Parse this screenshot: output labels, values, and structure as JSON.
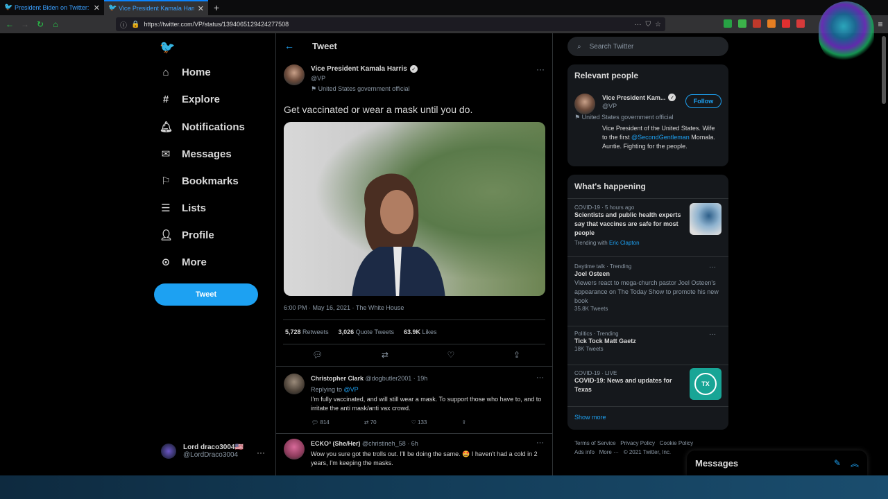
{
  "browser": {
    "tabs": [
      {
        "label": "President Biden on Twitter: \"Be",
        "active": false
      },
      {
        "label": "Vice President Kamala Harris",
        "active": true
      }
    ],
    "url": "https://twitter.com/VP/status/1394065129424277508"
  },
  "nav": {
    "items": [
      {
        "label": "Home",
        "icon": "home-icon"
      },
      {
        "label": "Explore",
        "icon": "hashtag-icon"
      },
      {
        "label": "Notifications",
        "icon": "bell-icon"
      },
      {
        "label": "Messages",
        "icon": "mail-icon"
      },
      {
        "label": "Bookmarks",
        "icon": "bookmark-icon"
      },
      {
        "label": "Lists",
        "icon": "list-icon"
      },
      {
        "label": "Profile",
        "icon": "person-icon"
      },
      {
        "label": "More",
        "icon": "more-circle-icon"
      }
    ],
    "tweet_button": "Tweet",
    "user": {
      "name": "Lord draco3004🇺🇸",
      "handle": "@LordDraco3004"
    }
  },
  "header": {
    "title": "Tweet"
  },
  "post": {
    "author": "Vice President Kamala Harris",
    "handle": "@VP",
    "label": "United States government official",
    "text": "Get vaccinated or wear a mask until you do.",
    "meta": "6:00 PM · May 16, 2021 · The White House",
    "retweets": "5,728",
    "retweets_label": "Retweets",
    "quotes": "3,026",
    "quotes_label": "Quote Tweets",
    "likes": "63.9K",
    "likes_label": "Likes"
  },
  "replies": [
    {
      "name": "Christopher Clark",
      "handle": "@dogbutler2001",
      "time": "19h",
      "replying": "Replying to",
      "replying_to": "@VP",
      "text": "I'm fully vaccinated, and will still wear a mask.  To support those who have to, and to irritate the anti mask/anti vax crowd.",
      "replies": "814",
      "retweets": "70",
      "likes": "133"
    },
    {
      "name": "ECKO³ (She/Her)",
      "handle": "@christineh_58",
      "time": "6h",
      "text": "Wow you sure got the trolls out. I'll be doing the same. 🤩 I haven't had a cold in 2 years, I'm keeping the masks."
    }
  ],
  "search": {
    "placeholder": "Search Twitter"
  },
  "relevant": {
    "title": "Relevant people",
    "name": "Vice President Kam...",
    "handle": "@VP",
    "label": "United States government official",
    "follow": "Follow",
    "bio_1": "Vice President of the United States.",
    "bio_2": "Wife to the first",
    "bio_link": "@SecondGentleman",
    "bio_3": "Momala. Auntie. Fighting for the people."
  },
  "happening": {
    "title": "What's happening",
    "trends": [
      {
        "cat": "COVID-19 · 5 hours ago",
        "title": "Scientists and public health experts say that vaccines are safe for most people",
        "sub": "Trending with",
        "sub_link": "Eric Clapton"
      },
      {
        "cat": "Daytime talk · Trending",
        "title": "Joel Osteen",
        "desc": "Viewers react to mega-church pastor Joel Osteen's appearance on The Today Show to promote his new book",
        "sub": "35.8K Tweets"
      },
      {
        "cat": "Politics · Trending",
        "title": "Tick Tock Matt Gaetz",
        "sub": "18K Tweets"
      },
      {
        "cat": "COVID-19 · LIVE",
        "title": "COVID-19: News and updates for Texas",
        "badge": "TX"
      }
    ],
    "show_more": "Show more"
  },
  "footer": {
    "links": [
      "Terms of Service",
      "Privacy Policy",
      "Cookie Policy",
      "Ads info",
      "More ···",
      "© 2021 Twitter, Inc."
    ]
  },
  "messages": {
    "title": "Messages"
  }
}
